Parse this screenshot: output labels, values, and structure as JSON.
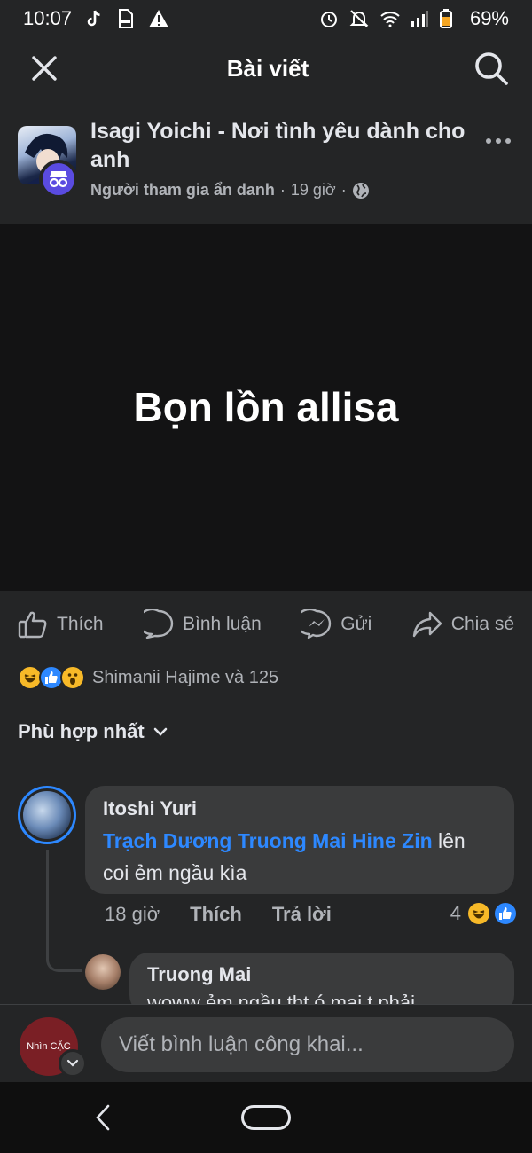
{
  "status": {
    "time": "10:07",
    "battery": "69%",
    "icons": [
      "tiktok-icon",
      "file-icon",
      "warning-icon",
      "alarm-icon",
      "mute-icon",
      "wifi-icon",
      "signal-icon",
      "battery-icon"
    ]
  },
  "topbar": {
    "title": "Bài viết",
    "close_icon": "close-icon",
    "search_icon": "search-icon"
  },
  "post": {
    "group_name": "Isagi Yoichi - Nơi tình yêu dành cho anh",
    "author": "Người tham gia ẩn danh",
    "time": "19 giờ",
    "separator": "·",
    "privacy_icon": "globe-icon",
    "body_text": "Bọn lồn allisa"
  },
  "actions": [
    {
      "label": "Thích",
      "icon": "like-icon"
    },
    {
      "label": "Bình luận",
      "icon": "comment-icon"
    },
    {
      "label": "Gửi",
      "icon": "messenger-icon"
    },
    {
      "label": "Chia sẻ",
      "icon": "share-icon"
    }
  ],
  "reactions_summary": {
    "text": "Shimanii Hajime và 125",
    "icons": [
      "haha-icon",
      "like-icon",
      "wow-icon"
    ]
  },
  "sort": {
    "label": "Phù hợp nhất"
  },
  "comments": [
    {
      "author": "Itoshi Yuri",
      "mention": "Trạch Dương Truong Mai Hine Zin",
      "text_after_mention": " lên coi ẻm ngầu kìa",
      "time": "18 giờ",
      "like_label": "Thích",
      "reply_label": "Trả lời",
      "reaction_count": "4"
    }
  ],
  "reply": {
    "author": "Truong Mai",
    "text": "woww ẻm ngầu tht ó mai t phải"
  },
  "composer": {
    "avatar_text": "Nhìn CẶC",
    "placeholder": "Viết bình luận công khai..."
  },
  "colors": {
    "background": "#242526",
    "bubble": "#3a3b3c",
    "accent": "#2d88ff",
    "text": "#e4e6eb",
    "muted": "#b0b3b8"
  }
}
